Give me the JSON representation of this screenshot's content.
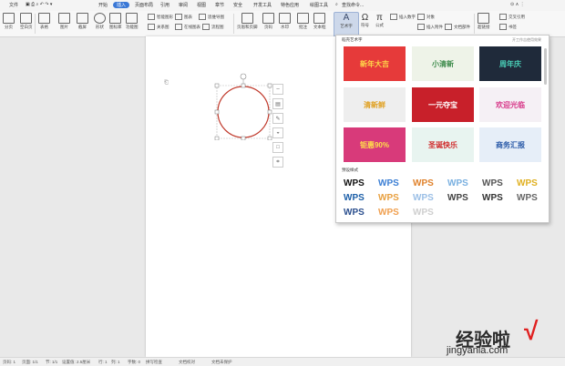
{
  "titlebar": {
    "file": "文件",
    "tabs": [
      "开始",
      "插入",
      "页面布局",
      "引用",
      "审阅",
      "视图",
      "章节",
      "安全",
      "开发工具",
      "特色应用",
      "绘图工具"
    ],
    "active_tab": "插入",
    "search_placeholder": "查找命令..."
  },
  "ribbon": {
    "left": [
      "分页",
      "空白页",
      "表格",
      "图片",
      "截屏",
      "形状",
      "图标库",
      "功能图"
    ],
    "smart": [
      "智能图形",
      "图表",
      "关系图",
      "在线图表",
      "思维导图",
      "流程图"
    ],
    "mid": [
      "页眉和页脚",
      "页码",
      "水印",
      "批注",
      "文本框"
    ],
    "art": "艺术字",
    "formula_symbol": [
      "符号",
      "公式"
    ],
    "right_small": [
      "插入数字",
      "对象",
      "插入附件",
      "文档部件",
      "超链接",
      "书签",
      "交叉引用"
    ]
  },
  "dropdown": {
    "recommended_title": "稻壳艺术字",
    "hint": "开工作吉使用效果",
    "thumbs": [
      "新年大吉",
      "小清新",
      "周年庆",
      "清新鲜",
      "一元夺宝",
      "欢迎光临",
      "钜惠90%",
      "圣诞快乐",
      "商务汇报"
    ],
    "preset_title": "预设样式",
    "wps_label": "WPS",
    "wps_colors": [
      "#111111",
      "#3c7fd4",
      "#e0822c",
      "#7ab0e0",
      "#555555",
      "#e0b020",
      "#666666",
      "#1c5fa8",
      "#e8a040",
      "#9bbfe6",
      "#444444",
      "#333333",
      "#2b4f8e",
      "#f0a050",
      "#cfcfcf"
    ]
  },
  "status": {
    "page": "页码: 1",
    "pages": "页面: 1/1",
    "section": "节: 1/1",
    "setting": "设置值: 2.5厘米",
    "row": "行: 1",
    "col": "列: 1",
    "words": "字数: 0",
    "spell": "拼写检查",
    "compare": "文档校对",
    "protect": "文档未保护"
  },
  "watermark": {
    "cn": "经验啦",
    "url": "jingyanla.com"
  }
}
